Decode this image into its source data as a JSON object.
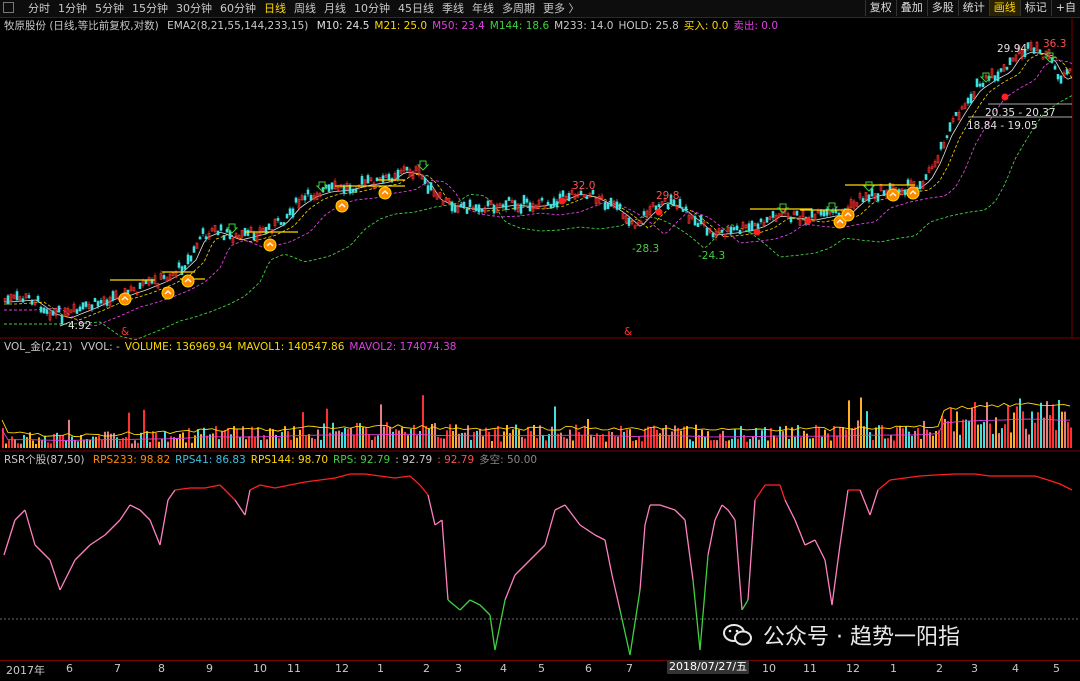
{
  "toolbar": {
    "tabs": [
      "分时",
      "1分钟",
      "5分钟",
      "15分钟",
      "30分钟",
      "60分钟",
      "日线",
      "周线",
      "月线",
      "10分钟",
      "45日线",
      "季线",
      "年线",
      "多周期",
      "更多 〉"
    ],
    "active_tab": "日线",
    "right_buttons": [
      "复权",
      "叠加",
      "多股",
      "统计",
      "画线",
      "标记",
      "+自"
    ],
    "active_right": "画线"
  },
  "main_panel": {
    "stock_label": "牧原股份 (日线,等比前复权,对数)",
    "indicator": "EMA2(8,21,55,144,233,15)",
    "values": [
      {
        "label": "M10: 24.5",
        "color": "#e0e0e0"
      },
      {
        "label": "M21: 25.0",
        "color": "#ffd800"
      },
      {
        "label": "M50: 23.4",
        "color": "#e040e0"
      },
      {
        "label": "M144: 18.6",
        "color": "#40d040"
      },
      {
        "label": "M233: 14.0",
        "color": "#c8c8c8"
      },
      {
        "label": "HOLD: 25.8",
        "color": "#c8c8c8"
      },
      {
        "label": "买入: 0.0",
        "color": "#ffd800"
      },
      {
        "label": "卖出: 0.0",
        "color": "#e040e0"
      }
    ],
    "price_annotations": [
      {
        "text": "29.94",
        "color": "#e0e0e0"
      },
      {
        "text": "36.3",
        "color": "#ff5050"
      },
      {
        "text": "20.35 - 20.37",
        "color": "#e0e0e0"
      },
      {
        "text": "18.84 - 19.05",
        "color": "#e0e0e0"
      },
      {
        "text": "32.0",
        "color": "#ff5050"
      },
      {
        "text": "29.8",
        "color": "#ff5050"
      },
      {
        "text": "-28.3",
        "color": "#40d040"
      },
      {
        "text": "-24.3",
        "color": "#40d040"
      },
      {
        "text": "4.92",
        "color": "#e0e0e0"
      },
      {
        "text": "&",
        "color": "#ff3030"
      },
      {
        "text": "&",
        "color": "#ff3030"
      }
    ]
  },
  "volume_panel": {
    "title": "VOL_金(2,21)",
    "values": [
      {
        "label": "VVOL: -",
        "color": "#c8c8c8"
      },
      {
        "label": "VOLUME: 136969.94",
        "color": "#ffd800"
      },
      {
        "label": "MAVOL1: 140547.86",
        "color": "#ffd800"
      },
      {
        "label": "MAVOL2: 174074.38",
        "color": "#e040e0"
      }
    ]
  },
  "rsr_panel": {
    "title": "RSR个股(87,50)",
    "values": [
      {
        "label": "RPS233: 98.82",
        "color": "#ff8c00"
      },
      {
        "label": "RPS41: 86.83",
        "color": "#40c0e0"
      },
      {
        "label": "RPS144: 98.70",
        "color": "#ffd800"
      },
      {
        "label": "RPS: 92.79",
        "color": "#40d040"
      },
      {
        "label": ": 92.79",
        "color": "#c8c8c8"
      },
      {
        "label": ": 92.79",
        "color": "#ff5050"
      },
      {
        "label": "多空: 50.00",
        "color": "#888888"
      }
    ]
  },
  "time_axis": {
    "labels": [
      "2017年",
      "6",
      "7",
      "8",
      "9",
      "10",
      "11",
      "12",
      "1",
      "2",
      "3",
      "4",
      "5",
      "6",
      "7",
      "2018/07/27/五",
      "10",
      "11",
      "12",
      "1",
      "2",
      "3",
      "4",
      "5"
    ]
  },
  "watermark": {
    "text": "公众号 · 趋势一阳指"
  },
  "colors": {
    "up": "#ff3030",
    "down": "#40e0e0",
    "ema_fast": "#ffd800",
    "ema_mid": "#e040e0",
    "ema_slow": "#40d040",
    "rsr_high": "#ff2020",
    "rsr_mid": "#ff80c0",
    "rsr_low": "#40d040"
  }
}
